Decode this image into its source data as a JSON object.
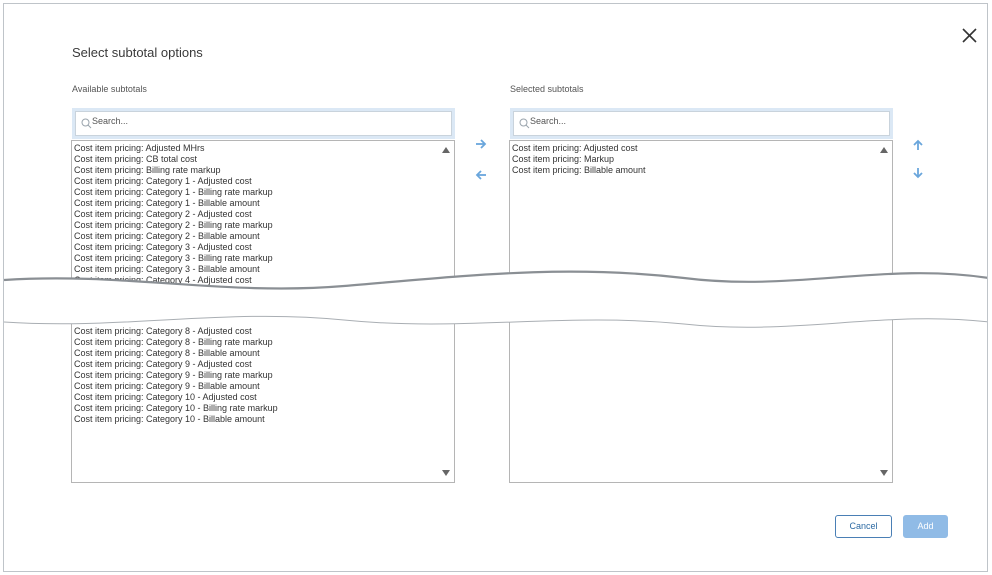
{
  "dialog": {
    "title": "Select subtotal options",
    "close_icon": "close-icon"
  },
  "available": {
    "label": "Available subtotals",
    "search_placeholder": "Search...",
    "items_top": [
      "Cost item pricing: Adjusted MHrs",
      "Cost item pricing: CB total cost",
      "Cost item pricing: Billing rate markup",
      "Cost item pricing: Category 1 - Adjusted cost",
      "Cost item pricing: Category 1 - Billing rate markup",
      "Cost item pricing: Category 1 - Billable amount",
      "Cost item pricing: Category 2 - Adjusted cost",
      "Cost item pricing: Category 2 - Billing rate markup",
      "Cost item pricing: Category 2 - Billable amount",
      "Cost item pricing: Category 3 - Adjusted cost",
      "Cost item pricing: Category 3 - Billing rate markup",
      "Cost item pricing: Category 3 - Billable amount",
      "Cost item pricing: Category 4 - Adjusted cost"
    ],
    "items_bottom": [
      "Cost item pricing: Category 8 - Adjusted cost",
      "Cost item pricing: Category 8 - Billing rate markup",
      "Cost item pricing: Category 8 - Billable amount",
      "Cost item pricing: Category 9 - Adjusted cost",
      "Cost item pricing: Category 9 - Billing rate markup",
      "Cost item pricing: Category 9 - Billable amount",
      "Cost item pricing: Category 10 - Adjusted cost",
      "Cost item pricing: Category 10 - Billing rate markup",
      "Cost item pricing: Category 10 - Billable amount"
    ]
  },
  "selected": {
    "label": "Selected subtotals",
    "search_placeholder": "Search...",
    "items": [
      "Cost item pricing: Adjusted cost",
      "Cost item pricing: Markup",
      "Cost item pricing: Billable amount"
    ]
  },
  "transfer": {
    "add_icon": "arrow-right-icon",
    "remove_icon": "arrow-left-icon"
  },
  "reorder": {
    "up_icon": "arrow-up-icon",
    "down_icon": "arrow-down-icon"
  },
  "footer": {
    "cancel_label": "Cancel",
    "add_label": "Add"
  },
  "colors": {
    "accent": "#4a90d9",
    "arrow": "#6aa6dc",
    "add_button": "#90bbe6",
    "search_frame": "#dbe8f5",
    "border": "#b5b5b5"
  }
}
